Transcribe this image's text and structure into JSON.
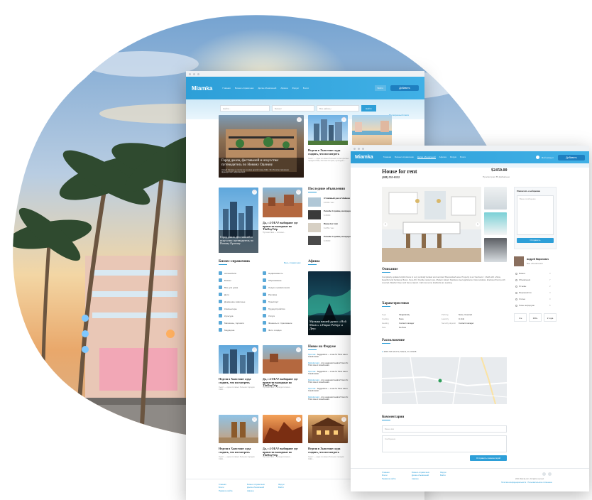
{
  "window1": {
    "logo": "Miamka",
    "nav": [
      "Главная",
      "Бизнес-справочник",
      "Доска объявлений",
      "Афиша",
      "Форум",
      "Блоги"
    ],
    "nav_right": "Войти",
    "add_button": "Добавить",
    "search": {
      "what_placeholder": "Найти...",
      "category_placeholder": "Бизнес",
      "location_placeholder": "Все районы",
      "button": "Найти",
      "advanced": "Расширенный поиск"
    },
    "featured": [
      {
        "title": "Город джаза, фестивалей и искусства: путеводитель по Новому Орлеану",
        "desc": "Новый Орлеан не похож ни на один другой город США. Это богатое смешение французской, африканской..."
      },
      {
        "title": "Неделя в Хьюстоне: куда сходить, что посмотреть",
        "desc": "Хьюст — один из самых больших и интересных городов США, богатая история, культура и..."
      }
    ],
    "latest_title": "Последние объявления",
    "latest": [
      {
        "title": "Отличный дом в Майами",
        "meta": "$ 1500 / мес"
      },
      {
        "title": "Porsche Cayenne, на продажу",
        "meta": "$ 45000"
      },
      {
        "title": "House for rent",
        "meta": "$ 2450 / мес"
      },
      {
        "title": "Porsche Cayenne, на продажу",
        "meta": "$ 45000"
      }
    ],
    "mid_cards": [
      {
        "title": "Город джаза, фестивалей и искусства: путеводитель по Новому Орлеану",
        "desc": ""
      },
      {
        "title": "Да, с 4 ОЕА? выбирают где провести выходные по TheDayTrip",
        "desc": "Путешествие — полезно..."
      }
    ],
    "biz_title": "Бизнес-справочник",
    "biz_link": "Весь справочник",
    "biz_col1": [
      "Автомобили",
      "Бизнес",
      "Все для дома",
      "Дети",
      "Домашние животные",
      "Компьютеры",
      "Культура",
      "Магазины, торговля",
      "Медицина"
    ],
    "biz_col2": [
      "Недвижимость",
      "Образование",
      "Отдых и развлечения",
      "Реклама",
      "Транспорт",
      "Трудоустройство",
      "Услуги",
      "Финансы и страхование",
      "Фото и видео"
    ],
    "afisha_title": "Афиша",
    "afisha_caption": "Музыка вашей души: «Holi Music» в Парке Роберт и Деус",
    "forum_title": "Новое на Форуме",
    "forum_items": [
      {
        "user": "Ярослав",
        "text": "Suggestions — Lmao 5x Think Like A Grandmaster."
      },
      {
        "user": "Mellodramatic",
        "text": "Any suggested readers? Here 5x Think Like A Grandmaster."
      },
      {
        "user": "Ярослав",
        "text": "Suggestions — Lmao 5x Think Like A Grandmaster."
      },
      {
        "user": "Mellodramatic",
        "text": "Any suggested readers? Here 5x Think Like A Grandmaster."
      },
      {
        "user": "Ярослав",
        "text": "Suggestions — Lmao 5x Think Like A Grandmaster."
      },
      {
        "user": "Mellodramatic",
        "text": "Any suggested readers? Here 5x Think Like A Grandmaster."
      }
    ],
    "blog_cards": [
      {
        "title": "Неделя в Хьюстоне: куда сходить, что посмотреть",
        "desc": "Хьюст — один из самых больших городов США..."
      },
      {
        "title": "Да, с 4 ОЕА? выбирают где провести выходные по TheDayTrip",
        "desc": "Путешествие — всегда полезно..."
      },
      {
        "title": "Неделя в Хьюстоне: куда сходить, что посмотреть",
        "desc": "Хьюст — один из самых больших городов США..."
      },
      {
        "title": "Да, с 4 ОЕА? выбирают где провести выходные по TheDayTrip",
        "desc": "Путешествие — всегда полезно..."
      },
      {
        "title": "Неделя в Хьюстоне: куда сходить, что посмотреть",
        "desc": "Хьюст — один из самых больших городов США..."
      }
    ],
    "footer_col1": [
      "Главная",
      "Блоги",
      "Правила сайта"
    ],
    "footer_col2": [
      "Бизнес-справочник",
      "Доска объявлений",
      "Афиша"
    ],
    "footer_col3": [
      "Форум",
      "Войти"
    ]
  },
  "window2": {
    "logo": "Miamka",
    "nav": [
      "Главная",
      "Бизнес-справочник",
      "Доска объявлений",
      "Афиша",
      "Форум",
      "Блоги"
    ],
    "nav_right": "Мой аккаунт",
    "add_button": "Добавить",
    "title": "House for rent",
    "price": "$2450.00",
    "phone": "(208) 555-0132",
    "views": "Просмотров: 85  Добавлено",
    "description_title": "Описание",
    "description": "Completely updated stylish home in very centrally located and serviced Shenandoah area. Property is a 2 bedroom / 1 bath with a New, beautiful and hardwood floors. New A/C. Double master tops, Modern island, Stainless steel appliances, New windows, Enclosed front porch covered, Washer Dryer and has a carport. Call now some landlords are seeking.",
    "specs_title": "Характеристики",
    "specs": [
      {
        "label": "Type",
        "value": "Singlefamily",
        "label2": "Parking",
        "value2": "None, Covered"
      },
      {
        "label": "Cooling",
        "value": "None",
        "label2": "Laundry",
        "value2": "In Unit"
      },
      {
        "label": "Heating",
        "value": "Contact manager",
        "label2": "Security deposit",
        "value2": "Contact manager"
      },
      {
        "label": "Pets",
        "value": "No Pets",
        "label2": "",
        "value2": ""
      }
    ],
    "location_title": "Расположение",
    "address": "2615 SW 2nd St, Miami, FL 33135",
    "comments_title": "Комментарии",
    "comment_name_placeholder": "Ваше имя",
    "comment_text_placeholder": "Сообщение",
    "comment_button": "Отправить комментарий",
    "message_title": "Написать сообщение",
    "message_placeholder": "Ваше сообщение",
    "message_button": "Отправить",
    "author_name": "Андрей Миронович",
    "author_sub": "Все объявления",
    "side_menu": [
      {
        "label": "Бизнес",
        "count": "3"
      },
      {
        "label": "Объявления",
        "count": "7"
      },
      {
        "label": "Отзывы",
        "count": "2"
      },
      {
        "label": "Мероприятия",
        "count": "3"
      },
      {
        "label": "Статьи",
        "count": "0"
      },
      {
        "label": "Темы на форуме",
        "count": "5"
      }
    ],
    "stats": [
      "1 м",
      "100+",
      "2 года"
    ],
    "footer_col1": [
      "Главная",
      "Блоги",
      "Правила сайта"
    ],
    "footer_col2": [
      "Бизнес-справочник",
      "Доска объявлений",
      "Афиша"
    ],
    "footer_col3": [
      "Форум",
      "Войти"
    ],
    "copyright": "2021 Miamka.com. All rights reserved.",
    "policy": "Политика конфиденциальности · Пользовательское соглашение"
  },
  "colors": {
    "accent": "#2d9fd8",
    "accent_dark": "#1e7fc0",
    "sky": "#5aa9d8"
  }
}
